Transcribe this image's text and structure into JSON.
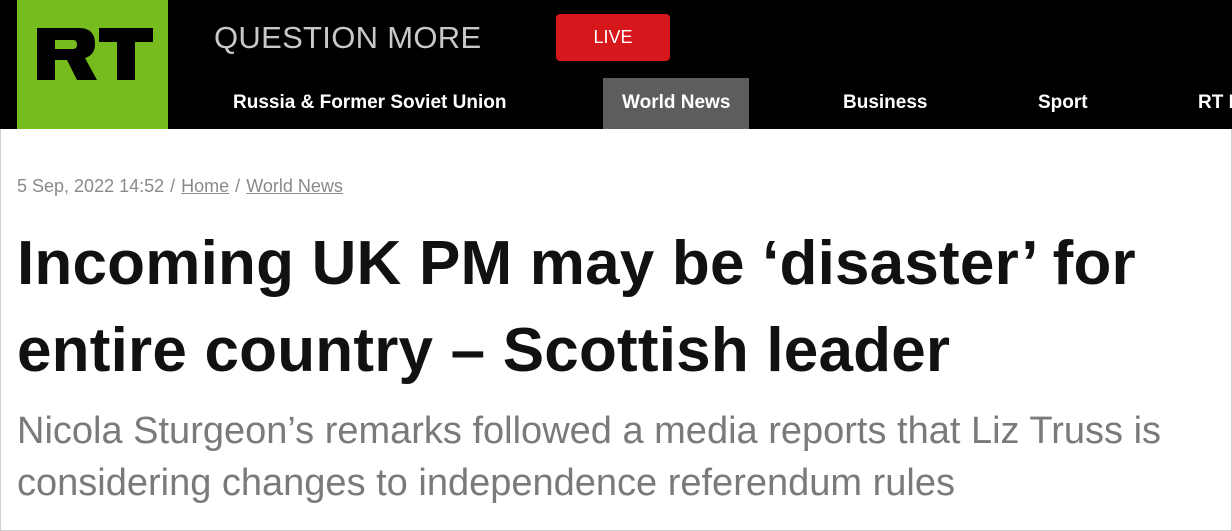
{
  "header": {
    "logo_text": "RT",
    "tagline": "QUESTION MORE",
    "live_label": "LIVE"
  },
  "nav": {
    "items": [
      {
        "label": "Russia & Former Soviet Union"
      },
      {
        "label": "World News",
        "active": true
      },
      {
        "label": "Business"
      },
      {
        "label": "Sport"
      },
      {
        "label": "RT I"
      }
    ]
  },
  "article": {
    "date": "5 Sep, 2022 14:52",
    "breadcrumb": [
      "Home",
      "World News"
    ],
    "headline": "Incoming UK PM may be ‘disaster’ for entire country – Scottish leader",
    "summary": "Nicola Sturgeon’s remarks followed a media reports that Liz Truss is considering changes to independence referendum rules"
  },
  "colors": {
    "brand_green": "#77bc1f",
    "live_red": "#d6171b",
    "header_bg": "#000000",
    "active_nav_bg": "#5d5d5d"
  }
}
